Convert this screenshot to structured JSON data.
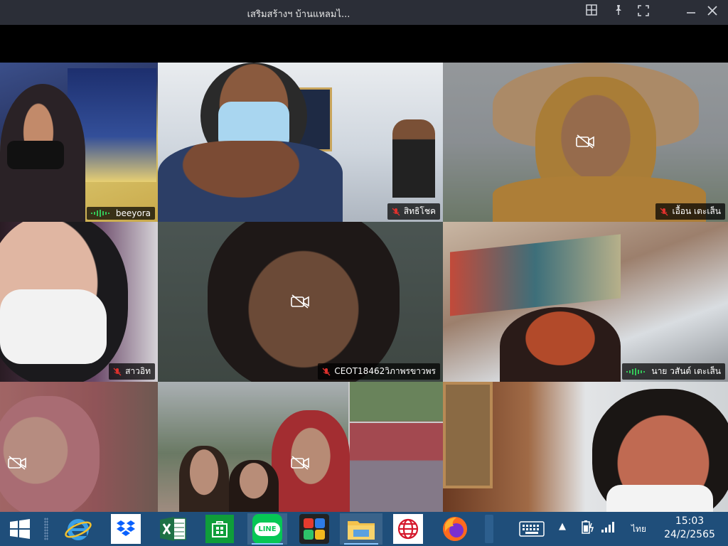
{
  "window": {
    "title": "เสริมสร้างฯ บ้านแหลมไ...",
    "buttons": [
      "layout-icon",
      "pin-icon",
      "fullscreen-icon",
      "minimize-icon",
      "close-icon"
    ]
  },
  "participants": [
    {
      "name": "beeyora",
      "mic": "speaking",
      "camera": "on",
      "active": true
    },
    {
      "name": "สิทธิโชค",
      "mic": "muted",
      "camera": "on",
      "active": false
    },
    {
      "name": "เอื้อน เตะเส็น",
      "mic": "muted",
      "camera": "off",
      "active": false
    },
    {
      "name": "สาวอิท",
      "mic": "muted",
      "camera": "on",
      "active": false
    },
    {
      "name": "CEOT18462วิภาพรขาวพร",
      "mic": "muted",
      "camera": "off",
      "active": false
    },
    {
      "name": "นาย วสันต์  เตะเส็น",
      "mic": "speaking",
      "camera": "on",
      "active": true
    },
    {
      "name": "",
      "mic": "",
      "camera": "off",
      "active": false
    },
    {
      "name": "",
      "mic": "",
      "camera": "off",
      "active": false
    },
    {
      "name": "",
      "mic": "",
      "camera": "on",
      "active": false
    }
  ],
  "taskbar": {
    "apps": [
      "windows-start-icon",
      "internet-explorer-icon",
      "dropbox-icon",
      "excel-icon",
      "store-icon",
      "line-icon",
      "puzzle-app-icon",
      "file-explorer-icon",
      "browser-globe-icon",
      "firefox-icon"
    ],
    "line_label": "LINE",
    "keyboard_lang": "ไทย",
    "time": "15:03",
    "date": "24/2/2565"
  },
  "colors": {
    "titlebar": "#2b2e37",
    "taskbar": "#1f4e7a",
    "active_border": "#34c759",
    "mic_muted": "#e0312d"
  }
}
